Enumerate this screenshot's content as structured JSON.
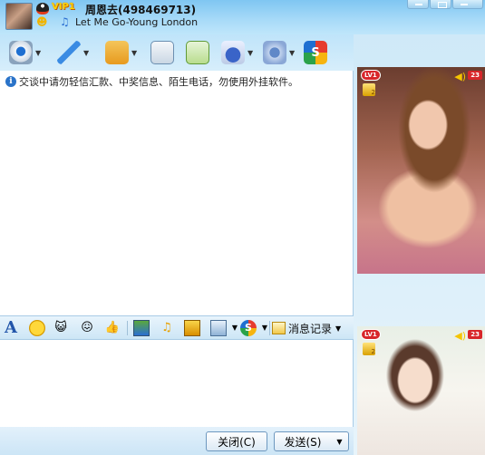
{
  "header": {
    "vip_label": "VIP1",
    "nickname": "周恩去(498469713)",
    "signature": "Let Me Go-Young London"
  },
  "toolbar": {
    "icons": [
      "camera-icon",
      "microphone-icon",
      "send-file-icon",
      "email-icon",
      "sms-icon",
      "remote-assist-icon",
      "settings-icon",
      "sogou-icon"
    ]
  },
  "message_area": {
    "notice": "交谈中请勿轻信汇款、中奖信息、陌生电话，勿使用外挂软件。"
  },
  "format_bar": {
    "font_label": "A",
    "history_label": "消息记录"
  },
  "buttons": {
    "close": "关闭(C)",
    "send": "发送(S)"
  },
  "side_panel": {
    "photo1": {
      "level": "LV1",
      "count": "23",
      "rank": "2"
    },
    "photo2": {
      "level": "LV1",
      "count": "23",
      "rank": "2"
    }
  },
  "colors": {
    "header_top": "#7fc6f2",
    "accent": "#2a73c9",
    "badge_red": "#d8262a"
  }
}
